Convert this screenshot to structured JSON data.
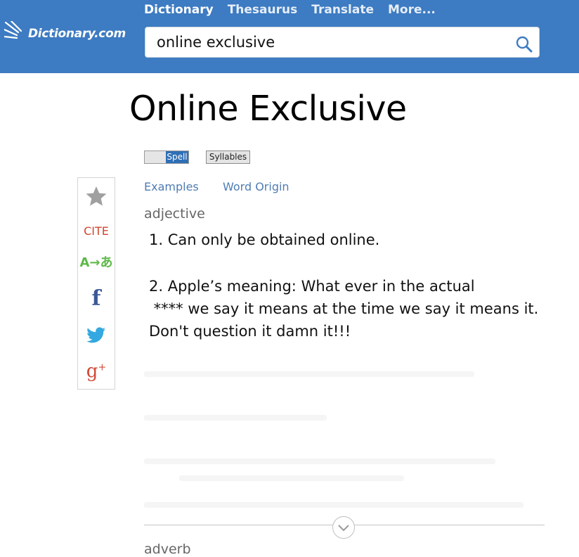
{
  "header": {
    "logo_text": "Dictionary.com",
    "nav": [
      "Dictionary",
      "Thesaurus",
      "Translate",
      "More..."
    ],
    "search_value": "online exclusive",
    "bg_color": "#3d7bc2"
  },
  "entry": {
    "title": "Online Exclusive",
    "spell_label": "Spell",
    "syllables_label": "Syllables",
    "tabs": [
      "Examples",
      "Word Origin"
    ],
    "part_of_speech": "adjective",
    "definitions": [
      [
        "1. Can only be obtained online."
      ],
      [
        "2. Apple’s meaning: What ever in the actual",
        " **** we say it means at the time we say it means it.",
        "Don't question it damn it!!!"
      ]
    ],
    "next_part_of_speech": "adverb"
  },
  "sidebar": {
    "cite_label": "CITE",
    "translate_label": "A→あ",
    "facebook_label": "f",
    "gplus_label": "g",
    "gplus_sup": "+",
    "icons": [
      "star-icon",
      "cite-icon",
      "translate-icon",
      "facebook-icon",
      "twitter-icon",
      "google-plus-icon"
    ]
  }
}
